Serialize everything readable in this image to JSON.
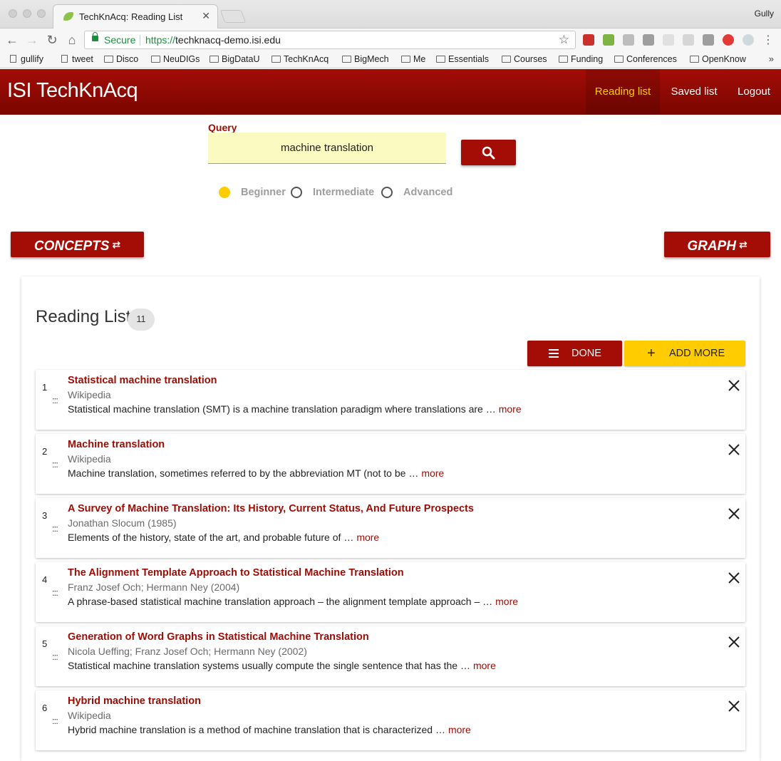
{
  "browser": {
    "tab_title": "TechKnAcq: Reading List",
    "tab_close": "✕",
    "user": "Gully",
    "secure_label": "Secure",
    "url_scheme": "https://",
    "url_rest": "techknacq-demo.isi.edu",
    "bookmarks": [
      {
        "label": "gullify",
        "kind": "page"
      },
      {
        "label": "tweet",
        "kind": "page"
      },
      {
        "label": "Disco",
        "kind": "folder"
      },
      {
        "label": "NeuDIGs",
        "kind": "folder"
      },
      {
        "label": "BigDataU",
        "kind": "folder"
      },
      {
        "label": "TechKnAcq",
        "kind": "folder"
      },
      {
        "label": "BigMech",
        "kind": "folder"
      },
      {
        "label": "Me",
        "kind": "folder"
      },
      {
        "label": "Essentials",
        "kind": "folder"
      },
      {
        "label": "Courses",
        "kind": "folder"
      },
      {
        "label": "Funding",
        "kind": "folder"
      },
      {
        "label": "Conferences",
        "kind": "folder"
      },
      {
        "label": "OpenKnow",
        "kind": "folder"
      }
    ],
    "bookmarks_more": "»"
  },
  "app": {
    "brand": "ISI TechKnAcq",
    "nav": {
      "reading_list": "Reading list",
      "saved_list": "Saved list",
      "logout": "Logout"
    },
    "accent": "#a30d06",
    "highlight": "#ffcc00"
  },
  "search": {
    "label": "Query",
    "value": "machine translation",
    "button_icon": "search-icon",
    "levels": [
      {
        "label": "Beginner",
        "selected": true
      },
      {
        "label": "Intermediate",
        "selected": false
      },
      {
        "label": "Advanced",
        "selected": false
      }
    ]
  },
  "panels": {
    "concepts": "CONCEPTS",
    "graph": "GRAPH",
    "toggle_glyph": "⇄"
  },
  "reading_list": {
    "title": "Reading List",
    "count": "11",
    "done_label": "DONE",
    "add_more_label": "ADD MORE",
    "add_more_glyph": "+",
    "more_label": "more",
    "ellipsis": "…",
    "drag_glyph": ":::",
    "items": [
      {
        "num": "1",
        "title": "Statistical machine translation",
        "source": "Wikipedia",
        "summary": "Statistical machine translation (SMT) is a machine translation paradigm where translations are"
      },
      {
        "num": "2",
        "title": "Machine translation",
        "source": "Wikipedia",
        "summary": "Machine translation, sometimes referred to by the abbreviation MT (not to be"
      },
      {
        "num": "3",
        "title": "A Survey of Machine Translation: Its History, Current Status, And Future Prospects",
        "source": "Jonathan Slocum (1985)",
        "summary": "Elements of the history, state of the art, and probable future of"
      },
      {
        "num": "4",
        "title": "The Alignment Template Approach to Statistical Machine Translation",
        "source": "Franz Josef Och; Hermann Ney (2004)",
        "summary": "A phrase-based statistical machine translation approach – the alignment template approach –"
      },
      {
        "num": "5",
        "title": "Generation of Word Graphs in Statistical Machine Translation",
        "source": "Nicola Ueffing; Franz Josef Och; Hermann Ney (2002)",
        "summary": "Statistical machine translation systems usually compute the single sentence that has the"
      },
      {
        "num": "6",
        "title": "Hybrid machine translation",
        "source": "Wikipedia",
        "summary": "Hybrid machine translation is a method of machine translation that is characterized"
      }
    ]
  }
}
